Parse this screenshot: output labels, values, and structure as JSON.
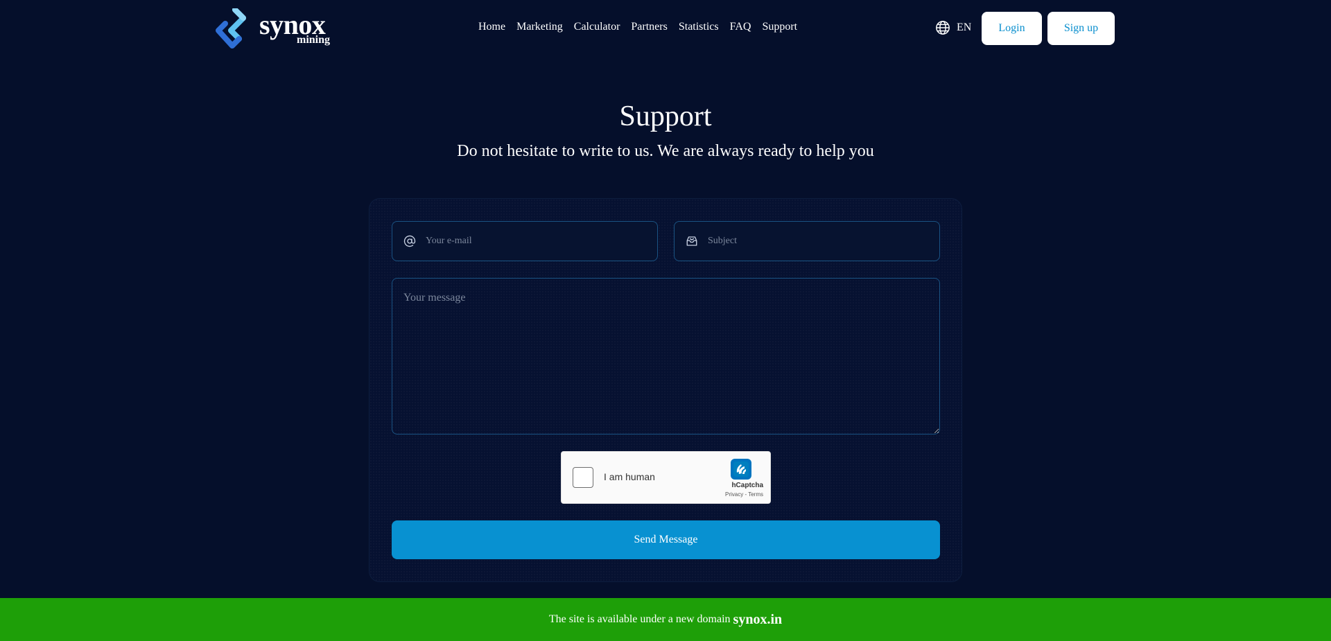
{
  "brand": {
    "name": "synox",
    "sub": "mining",
    "icon": "synox-logo-icon"
  },
  "nav": {
    "items": [
      "Home",
      "Marketing",
      "Calculator",
      "Partners",
      "Statistics",
      "FAQ",
      "Support"
    ]
  },
  "language": {
    "icon": "globe-icon",
    "code": "EN"
  },
  "auth": {
    "login_label": "Login",
    "signup_label": "Sign up"
  },
  "page": {
    "title": "Support",
    "subtitle": "Do not hesitate to write to us. We are always ready to help you"
  },
  "form": {
    "email": {
      "placeholder": "Your e-mail",
      "value": "",
      "icon": "at-sign-icon"
    },
    "subject": {
      "placeholder": "Subject",
      "value": "",
      "icon": "mail-inbox-icon"
    },
    "message": {
      "placeholder": "Your message",
      "value": ""
    },
    "send_label": "Send Message"
  },
  "captcha": {
    "label": "I am human",
    "brand": "hCaptcha",
    "links": "Privacy - Terms",
    "checked": false
  },
  "banner": {
    "text": "The site is available under a new domain",
    "domain": "synox.in"
  },
  "colors": {
    "background": "#050f2b",
    "accent": "#0891d1",
    "banner": "#1e9f08"
  }
}
